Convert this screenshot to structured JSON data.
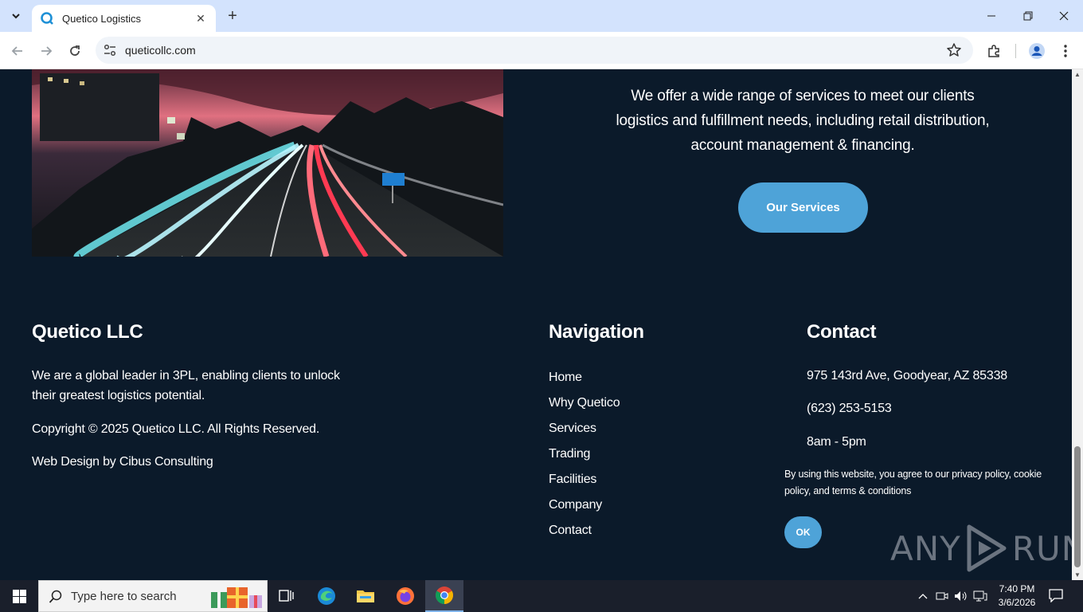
{
  "browser": {
    "tab_title": "Quetico Logistics",
    "url": "queticollc.com"
  },
  "hero": {
    "services_text": "We offer a wide range of services to meet our clients logistics and fulfillment needs, including retail distribution, account management & financing.",
    "services_button": "Our Services"
  },
  "footer": {
    "company": {
      "heading": "Quetico LLC",
      "tagline": "We are a global leader in 3PL, enabling clients to unlock their greatest logistics potential.",
      "copyright": "Copyright © 2025 Quetico LLC. All Rights Reserved.",
      "credit": "Web Design by Cibus Consulting"
    },
    "navigation": {
      "heading": "Navigation",
      "items": [
        "Home",
        "Why Quetico",
        "Services",
        "Trading",
        "Facilities",
        "Company",
        "Contact"
      ]
    },
    "contact": {
      "heading": "Contact",
      "address": "975 143rd Ave, Goodyear, AZ 85338",
      "phone": "(623) 253-5153",
      "hours": "8am - 5pm"
    }
  },
  "cookie_banner": {
    "text": "By using this website, you agree to our privacy policy, cookie policy, and terms & conditions",
    "ok_label": "OK"
  },
  "watermark": {
    "left": "ANY",
    "right": "RUN"
  },
  "taskbar": {
    "search_placeholder": "Type here to search",
    "time": "7:40 PM",
    "date": "3/6/2026"
  },
  "colors": {
    "page_bg": "#0b1a2a",
    "accent": "#4ea3d8",
    "tabbar": "#d3e3fd"
  }
}
